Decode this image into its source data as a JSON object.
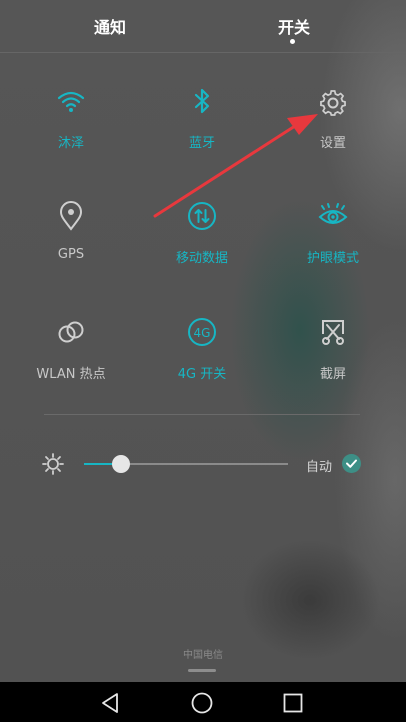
{
  "header": {
    "tabs": [
      {
        "label": "通知",
        "active": false
      },
      {
        "label": "开关",
        "active": true
      }
    ]
  },
  "tiles": [
    {
      "label": "沐泽",
      "icon": "wifi-icon",
      "state": "on"
    },
    {
      "label": "蓝牙",
      "icon": "bluetooth-icon",
      "state": "on"
    },
    {
      "label": "设置",
      "icon": "gear-icon",
      "state": "off"
    },
    {
      "label": "GPS",
      "icon": "location-pin-icon",
      "state": "off"
    },
    {
      "label": "移动数据",
      "icon": "mobile-data-icon",
      "state": "on"
    },
    {
      "label": "护眼模式",
      "icon": "eye-icon",
      "state": "on"
    },
    {
      "label": "WLAN 热点",
      "icon": "hotspot-icon",
      "state": "off"
    },
    {
      "label": "4G 开关",
      "icon": "4g-icon",
      "state": "on"
    },
    {
      "label": "截屏",
      "icon": "screenshot-icon",
      "state": "off"
    }
  ],
  "brightness": {
    "level_fraction": 0.18,
    "auto_label": "自动",
    "auto_checked": true
  },
  "carrier": "中国电信",
  "navbar": [
    "back-icon",
    "home-icon",
    "recents-icon"
  ],
  "colors": {
    "accent": "#17b6c4",
    "annotation_arrow": "#e8383d",
    "background": "#545454"
  }
}
